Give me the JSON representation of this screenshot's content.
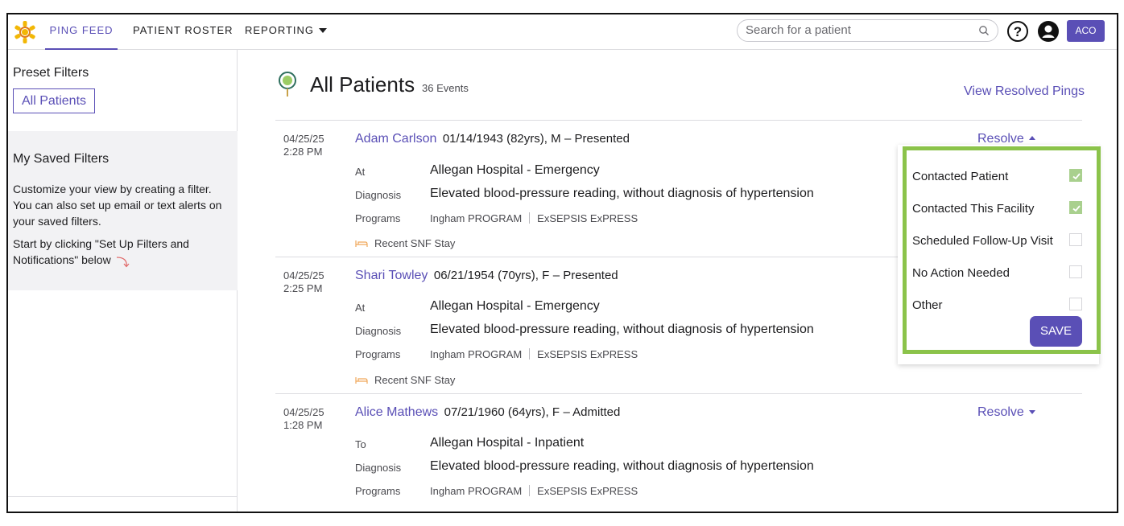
{
  "nav": {
    "items": [
      "PING FEED",
      "PATIENT ROSTER",
      "REPORTING"
    ],
    "active": "PING FEED",
    "search_placeholder": "Search for a patient",
    "account_button": "ACO",
    "accent_color": "#5a4fb6"
  },
  "sidebar": {
    "preset_title": "Preset Filters",
    "preset_chip": "All Patients",
    "saved_title": "My Saved Filters",
    "saved_text": "Customize your view by creating a filter. You can also set up email or text alerts on your saved filters.",
    "saved_text2": "Start by clicking \"Set Up Filters and Notifications\" below"
  },
  "main": {
    "title": "All Patients",
    "event_count": "36 Events",
    "view_resolved": "View Resolved Pings"
  },
  "entries": [
    {
      "date": "04/25/25",
      "time": "2:28 PM",
      "name": "Adam Carlson",
      "dob": "01/14/1943 (82yrs), M",
      "status": "– Presented",
      "loc_label": "At",
      "location": "Allegan Hospital - Emergency",
      "diag_label": "Diagnosis",
      "diagnosis": "Elevated blood-pressure reading, without diagnosis of hypertension",
      "prog_label": "Programs",
      "programs": [
        "Ingham PROGRAM",
        "ExSEPSIS ExPRESS"
      ],
      "snf": "Recent SNF Stay",
      "resolve": "Resolve"
    },
    {
      "date": "04/25/25",
      "time": "2:25 PM",
      "name": "Shari Towley",
      "dob": "06/21/1954 (70yrs), F",
      "status": "– Presented",
      "loc_label": "At",
      "location": "Allegan Hospital - Emergency",
      "diag_label": "Diagnosis",
      "diagnosis": "Elevated blood-pressure reading, without diagnosis of hypertension",
      "prog_label": "Programs",
      "programs": [
        "Ingham PROGRAM",
        "ExSEPSIS ExPRESS"
      ],
      "snf": "Recent SNF Stay"
    },
    {
      "date": "04/25/25",
      "time": "1:28 PM",
      "name": "Alice Mathews",
      "dob": "07/21/1960 (64yrs), F",
      "status": "– Admitted",
      "loc_label": "To",
      "location": "Allegan Hospital - Inpatient",
      "diag_label": "Diagnosis",
      "diagnosis": "Elevated blood-pressure reading, without diagnosis of hypertension",
      "prog_label": "Programs",
      "programs": [
        "Ingham PROGRAM",
        "ExSEPSIS ExPRESS"
      ],
      "resolve": "Resolve"
    }
  ],
  "resolve_menu": {
    "options": [
      {
        "label": "Contacted Patient",
        "checked": true
      },
      {
        "label": "Contacted This Facility",
        "checked": true
      },
      {
        "label": "Scheduled Follow-Up Visit",
        "checked": false
      },
      {
        "label": "No Action Needed",
        "checked": false
      },
      {
        "label": "Other",
        "checked": false
      }
    ],
    "save_label": "SAVE",
    "highlight_color": "#8bc34a"
  }
}
